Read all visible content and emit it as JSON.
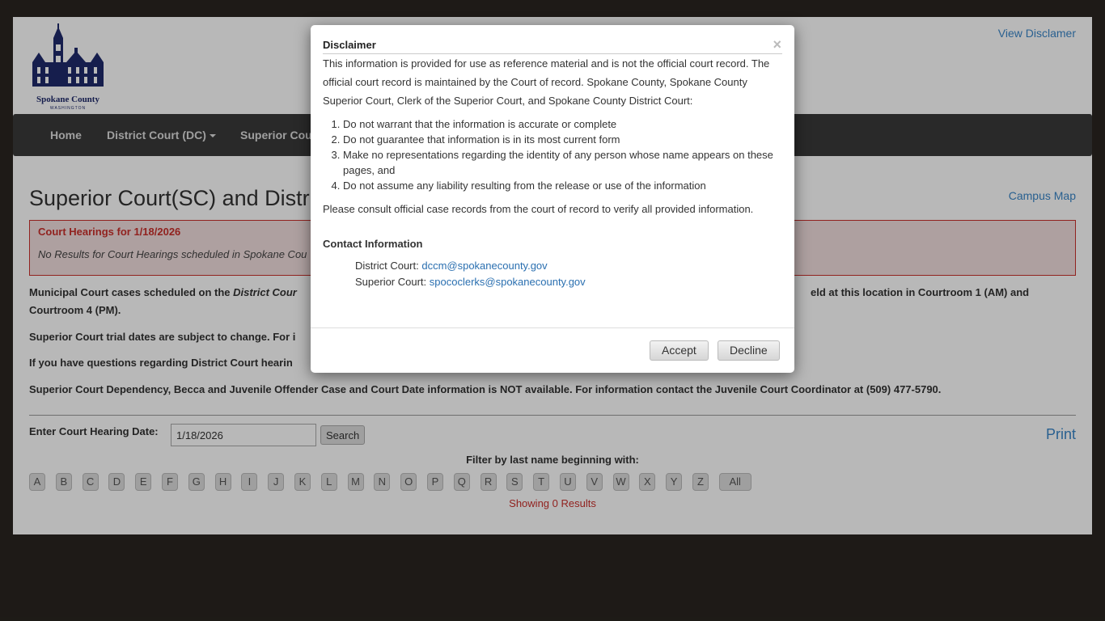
{
  "header": {
    "logo_text": "Spokane County",
    "logo_sub": "WASHINGTON",
    "view_disclaimer": "View Disclamer"
  },
  "nav": {
    "items": [
      {
        "label": "Home"
      },
      {
        "label": "District Court (DC)",
        "dropdown": true
      },
      {
        "label": "Superior Cou"
      }
    ]
  },
  "main": {
    "title": "Superior Court(SC) and Distri",
    "campus_map": "Campus Map",
    "alert_title": "Court Hearings for 1/18/2026",
    "alert_body": "No Results for Court Hearings scheduled in Spokane Cou",
    "para1_a": "Municipal Court cases scheduled on the ",
    "para1_b": "District Cour",
    "para1_c": "eld at this location in Courtroom 1 (AM) and",
    "para1_d": "Courtroom 4 (PM).",
    "para2": "Superior Court trial dates are subject to change. For i",
    "para3": "If you have questions regarding District Court hearin",
    "para4": "Superior Court Dependency, Becca and Juvenile Offender Case and Court Date information is NOT available. For information contact the Juvenile Court Coordinator at (509) 477-5790.",
    "date_label": "Enter Court Hearing Date:",
    "date_value": "1/18/2026",
    "search_label": "Search",
    "print_label": "Print",
    "filter_label": "Filter by last name beginning with:",
    "letters": [
      "A",
      "B",
      "C",
      "D",
      "E",
      "F",
      "G",
      "H",
      "I",
      "J",
      "K",
      "L",
      "M",
      "N",
      "O",
      "P",
      "Q",
      "R",
      "S",
      "T",
      "U",
      "V",
      "W",
      "X",
      "Y",
      "Z"
    ],
    "all_label": "All",
    "showing": "Showing 0 Results"
  },
  "modal": {
    "title": "Disclaimer",
    "close": "×",
    "intro": "This information is provided for use as reference material and is not the official court record. The official court record is maintained by the Court of record. Spokane County, Spokane County Superior Court, Clerk of the Superior Court, and Spokane County District Court:",
    "items": [
      "Do not warrant that the information is accurate or complete",
      "Do not guarantee that information is in its most current form",
      "Make no representations regarding the identity of any person whose name appears on these pages, and",
      "Do not assume any liability resulting from the release or use of the information"
    ],
    "consult": "Please consult official case records from the court of record to verify all provided information.",
    "contact_heading": "Contact Information",
    "district_label": "District Court: ",
    "district_email": "dccm@spokanecounty.gov",
    "superior_label": "Superior Court: ",
    "superior_email": "spococlerks@spokanecounty.gov",
    "accept": "Accept",
    "decline": "Decline"
  }
}
